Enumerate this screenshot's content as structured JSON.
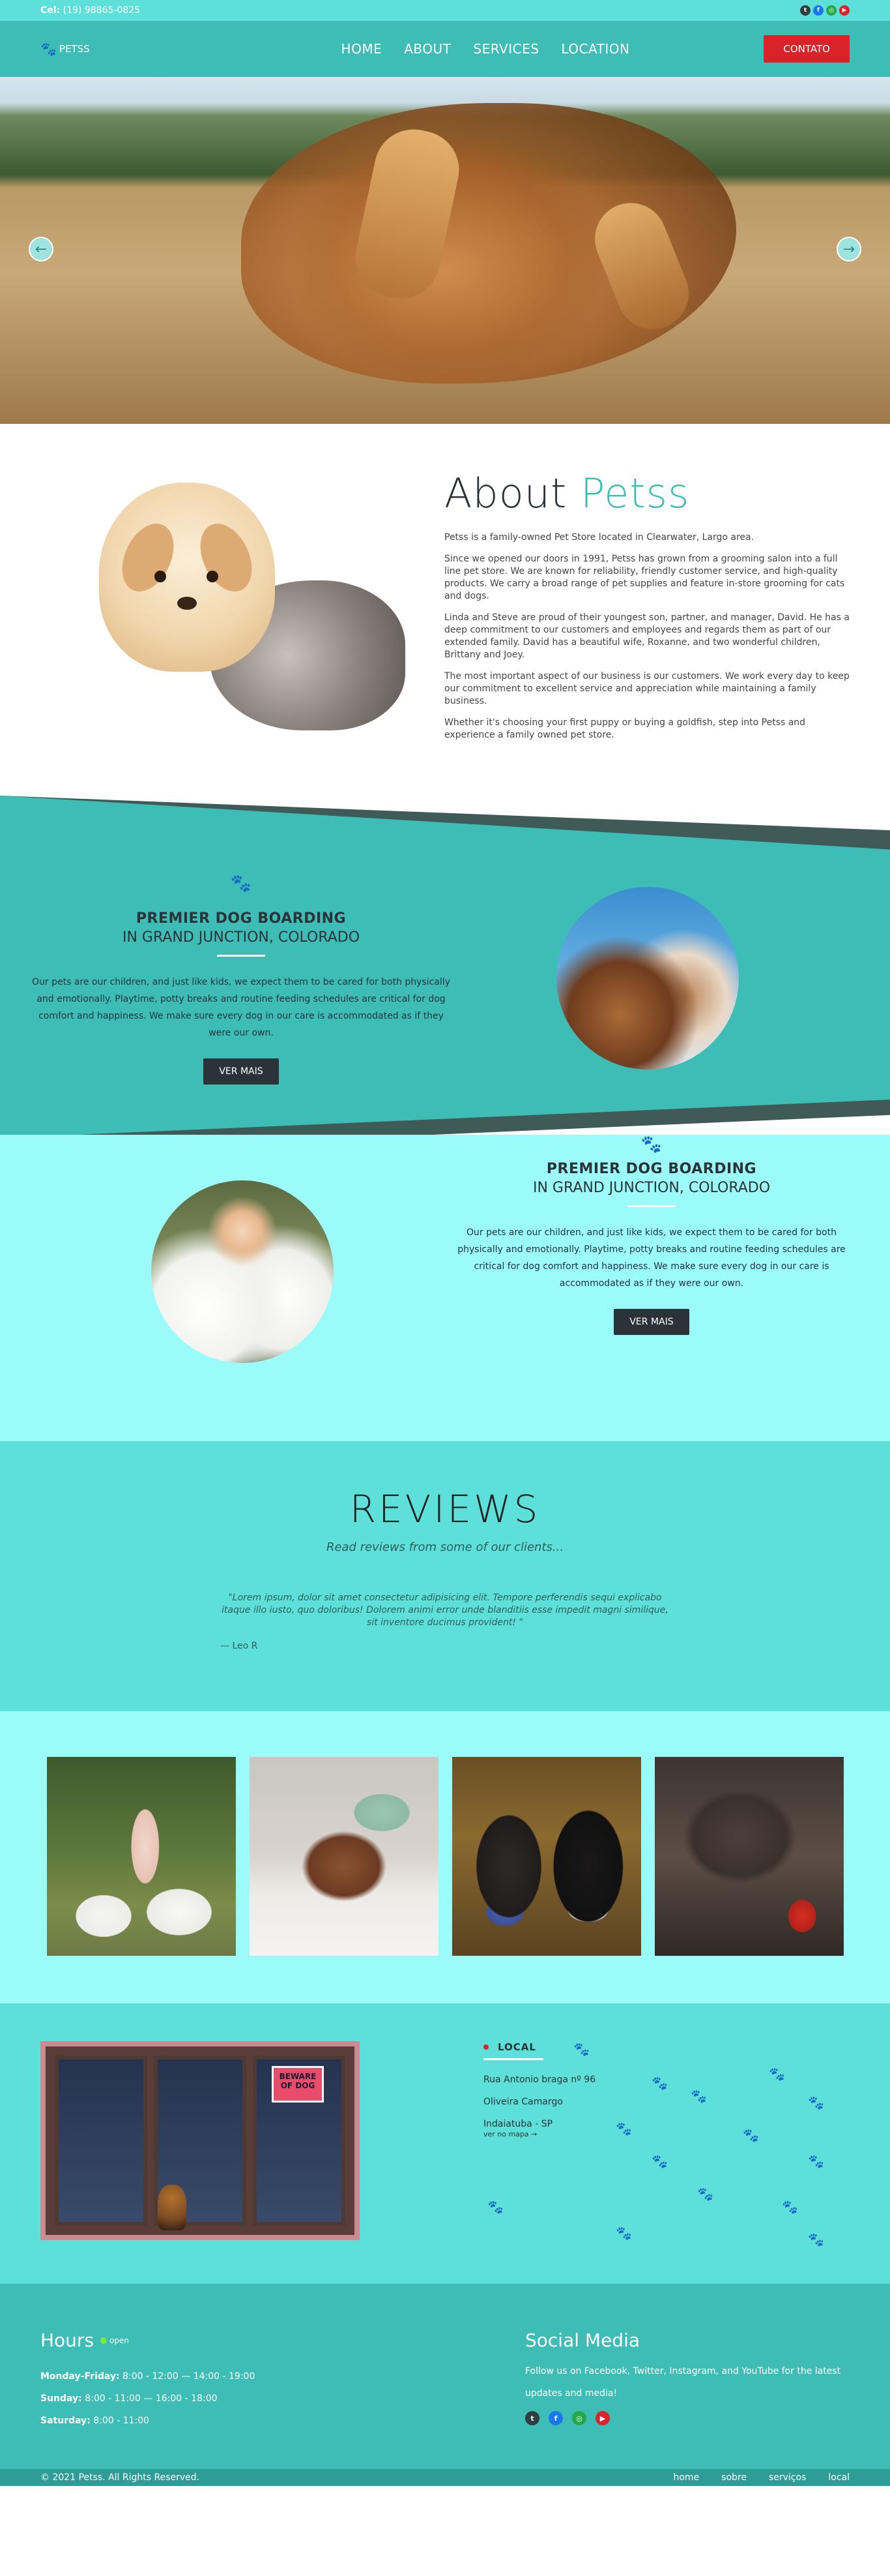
{
  "topbar": {
    "phone_label": "Cel:",
    "phone": "(19) 98865-0825"
  },
  "nav": {
    "logo": "PETSS",
    "items": [
      "HOME",
      "ABOUT",
      "SERVICES",
      "LOCATION"
    ],
    "cta": "CONTATO"
  },
  "about": {
    "title_a": "About",
    "title_b": "Petss",
    "paragraphs": [
      "Petss is a family-owned Pet Store located in Clearwater, Largo area.",
      "Since we opened our doors in 1991, Petss has grown from a grooming salon into a full line pet store. We are known for reliability, friendly customer service, and high-quality products. We carry a broad range of pet supplies and feature in-store grooming for cats and dogs.",
      "Linda and Steve are proud of their youngest son, partner, and manager, David. He has a deep commitment to our customers and employees and regards them as part of our extended family. David has a beautiful wife, Roxanne, and two wonderful children, Brittany and Joey.",
      "The most important aspect of our business is our customers. We work every day to keep our commitment to excellent service and appreciation while maintaining a family business.",
      "Whether it's choosing your first puppy or buying a goldfish, step into Petss and experience a family owned pet store."
    ]
  },
  "boarding": [
    {
      "title": "PREMIER DOG BOARDING",
      "subtitle": "IN GRAND JUNCTION, COLORADO",
      "text": "Our pets are our children, and just like kids, we expect them to be cared for both physically and emotionally. Playtime, potty breaks and routine feeding schedules are critical for dog comfort and happiness. We make sure every dog in our care is accommodated as if they were our own.",
      "button": "VER MAIS"
    },
    {
      "title": "PREMIER DOG BOARDING",
      "subtitle": "IN GRAND JUNCTION, COLORADO",
      "text": "Our pets are our children, and just like kids, we expect them to be cared for both physically and emotionally. Playtime, potty breaks and routine feeding schedules are critical for dog comfort and happiness. We make sure every dog in our care is accommodated as if they were our own.",
      "button": "VER MAIS"
    }
  ],
  "reviews": {
    "title": "REVIEWS",
    "subtitle": "Read reviews from some of our clients...",
    "quote": "\"Lorem ipsum, dolor sit amet consectetur adipisicing elit. Tempore perferendis sequi explicabo itaque illo iusto, quo doloribus! Dolorem animi error unde blanditiis esse impedit magni similique, sit inventore ducimus provident! \"",
    "author": "— Leo R"
  },
  "local": {
    "heading": "LOCAL",
    "address": [
      "Rua Antonio braga nº 96",
      "Oliveira Camargo",
      "Indaiatuba - SP"
    ],
    "more": "ver no mapa →",
    "sign": "BEWARE OF DOG"
  },
  "footer": {
    "hours_title": "Hours",
    "open": "open",
    "hours": [
      {
        "day": "Monday-Friday:",
        "time": " 8:00 - 12:00 — 14:00 - 19:00"
      },
      {
        "day": "Sunday:",
        "time": " 8:00 - 11:00 — 16:00 - 18:00"
      },
      {
        "day": "Saturday:",
        "time": " 8:00 - 11:00"
      }
    ],
    "social_title": "Social Media",
    "social_text": "Follow us on Facebook, Twitter, Instagram, and YouTube for the latest updates and media!"
  },
  "bottom": {
    "copyright": "© 2021 Petss. All Rights Reserved.",
    "links": [
      "home",
      "sobre",
      "serviços",
      "local"
    ]
  },
  "colors": {
    "teal": "#3dbdb5",
    "aqua": "#5ee0da",
    "light_aqua": "#9afbf8",
    "red": "#d9222a",
    "dark": "#2c3338"
  },
  "icons": [
    "paw-icon",
    "arrow-left-icon",
    "arrow-right-icon",
    "facebook-icon",
    "twitter-icon",
    "instagram-icon",
    "youtube-icon"
  ]
}
